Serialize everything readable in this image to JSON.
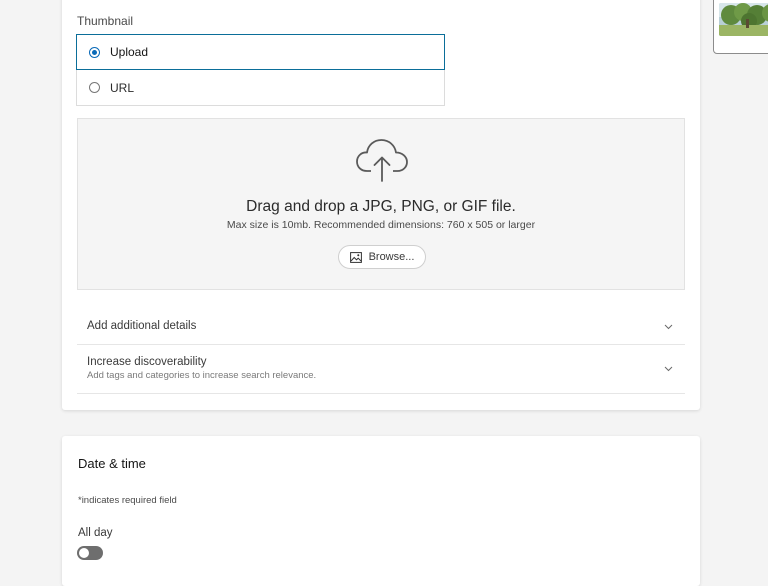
{
  "thumbnail": {
    "label": "Thumbnail",
    "options": [
      {
        "label": "Upload",
        "selected": true
      },
      {
        "label": "URL",
        "selected": false
      }
    ]
  },
  "dropzone": {
    "icon": "cloud-upload-icon",
    "title": "Drag and drop a JPG, PNG, or GIF file.",
    "subtitle": "Max size is 10mb. Recommended dimensions: 760 x 505 or larger",
    "browse_icon": "image-icon",
    "browse_label": "Browse..."
  },
  "accordions": [
    {
      "title": "Add additional details",
      "subtitle": "",
      "icon": "chevron-down-icon"
    },
    {
      "title": "Increase discoverability",
      "subtitle": "Add tags and categories to increase search relevance.",
      "icon": "chevron-down-icon"
    }
  ],
  "date_time": {
    "title": "Date & time",
    "required_note": "*indicates required field",
    "all_day_label": "All day",
    "all_day_on": false
  },
  "colors": {
    "accent": "#0a6ab8",
    "selected_border": "#0b6e99",
    "page_background": "#f4f4f4",
    "toggle_off": "#6e6e6e"
  }
}
